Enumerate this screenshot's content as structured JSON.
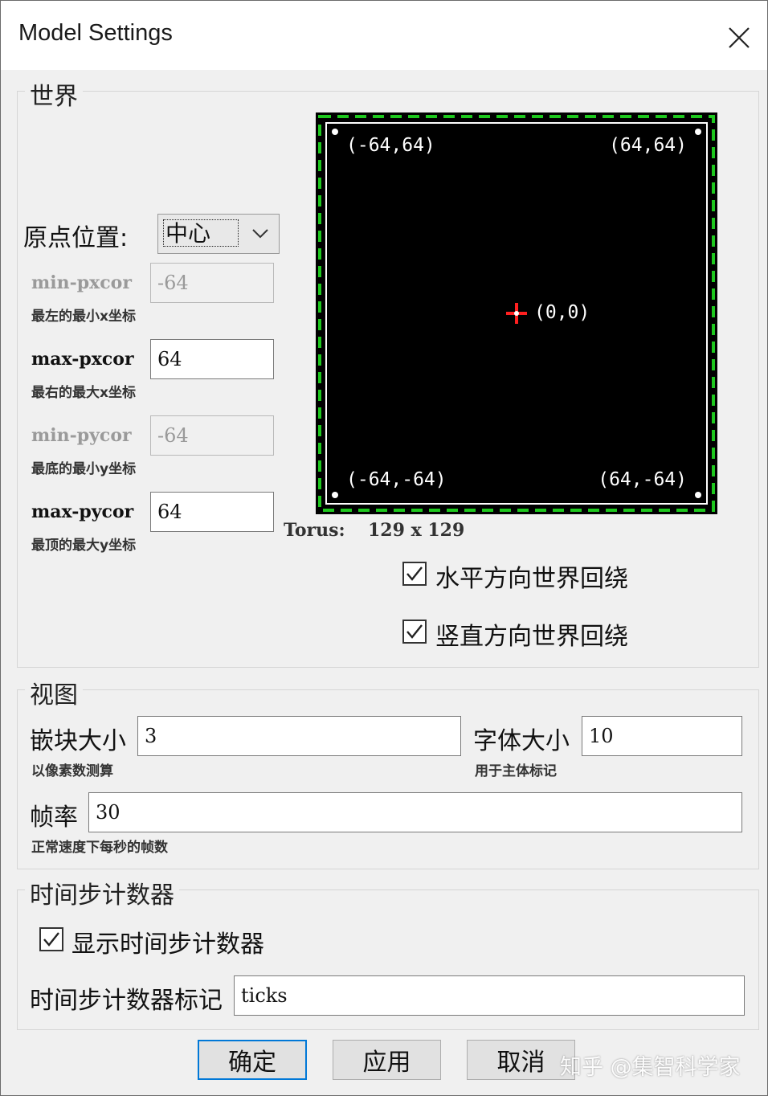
{
  "window": {
    "title": "Model Settings"
  },
  "world": {
    "legend": "世界",
    "origin_label": "原点位置:",
    "origin_value": "中心",
    "min_pxcor": {
      "label": "min-pxcor",
      "value": "-64",
      "hint": "最左的最小x坐标"
    },
    "max_pxcor": {
      "label": "max-pxcor",
      "value": "64",
      "hint": "最右的最大x坐标"
    },
    "min_pycor": {
      "label": "min-pycor",
      "value": "-64",
      "hint": "最底的最小y坐标"
    },
    "max_pycor": {
      "label": "max-pycor",
      "value": "64",
      "hint": "最顶的最大y坐标"
    },
    "preview": {
      "top_left": "(-64,64)",
      "top_right": "(64,64)",
      "center": "(0,0)",
      "bottom_left": "(-64,-64)",
      "bottom_right": "(64,-64)",
      "border_color": "#1ec81e",
      "center_marker_color": "#ff2020"
    },
    "torus_label": "Torus:",
    "torus_size": "129 x 129",
    "wrap_horizontal": {
      "label": "水平方向世界回绕",
      "checked": true
    },
    "wrap_vertical": {
      "label": "竖直方向世界回绕",
      "checked": true
    }
  },
  "view": {
    "legend": "视图",
    "patch_size_label": "嵌块大小",
    "patch_size_value": "3",
    "patch_size_hint": "以像素数测算",
    "font_size_label": "字体大小",
    "font_size_value": "10",
    "font_size_hint": "用于主体标记",
    "frame_rate_label": "帧率",
    "frame_rate_value": "30",
    "frame_rate_hint": "正常速度下每秒的帧数"
  },
  "tick_counter": {
    "legend": "时间步计数器",
    "show_label": "显示时间步计数器",
    "show_checked": true,
    "label_label": "时间步计数器标记",
    "label_value": "ticks"
  },
  "buttons": {
    "ok": "确定",
    "apply": "应用",
    "cancel": "取消"
  },
  "watermark": "知乎 @集智科学家"
}
